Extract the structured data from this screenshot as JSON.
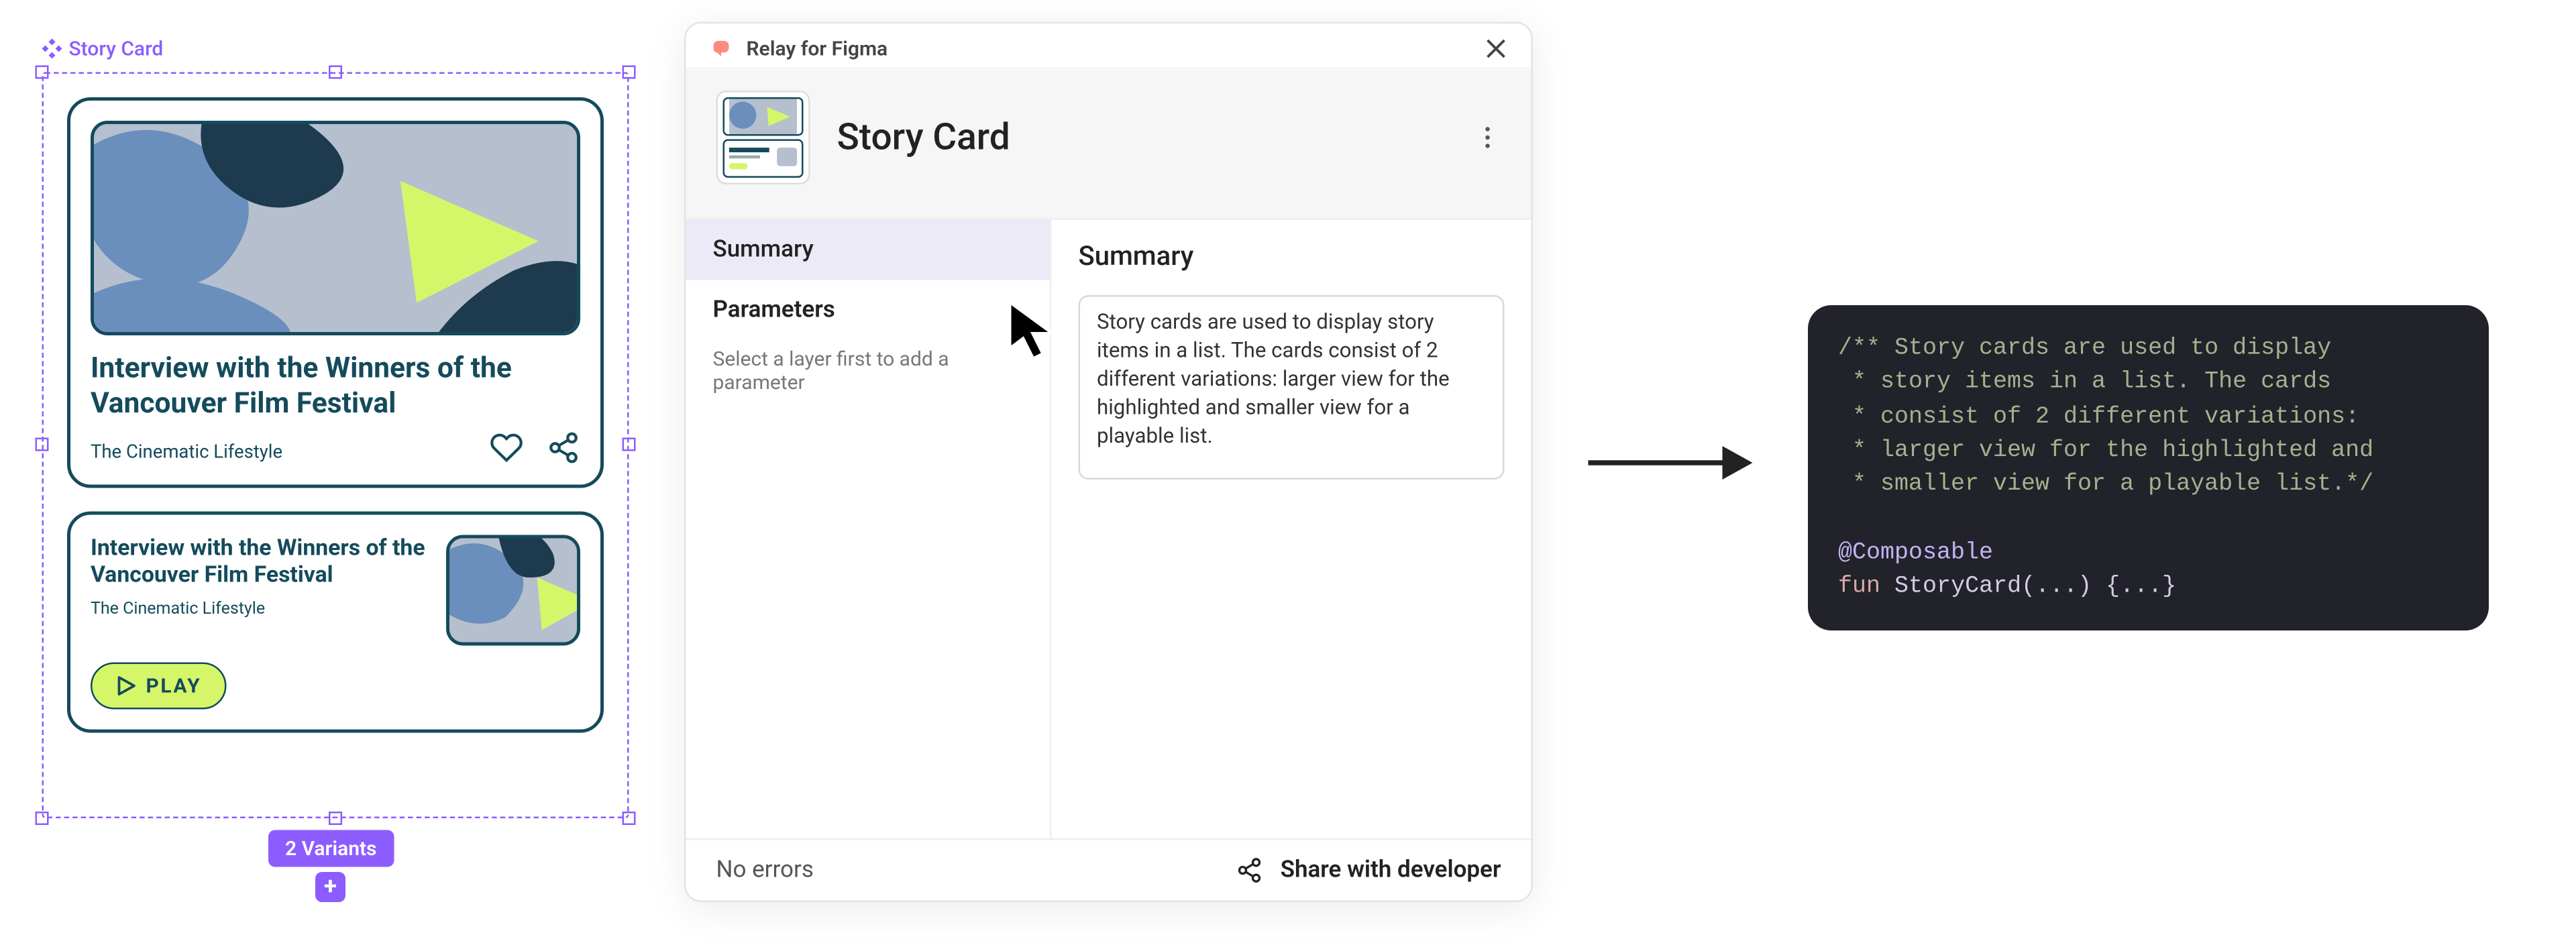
{
  "figma": {
    "component_label": "Story Card",
    "variants_badge": "2 Variants"
  },
  "card_large": {
    "title": "Interview with the Winners of the Vancouver Film Festival",
    "subtitle": "The Cinematic Lifestyle"
  },
  "card_small": {
    "title": "Interview with the Winners of the Vancouver Film Festival",
    "subtitle": "The Cinematic Lifestyle",
    "play_label": "PLAY"
  },
  "panel": {
    "plugin_name": "Relay for Figma",
    "title": "Story Card",
    "tabs": {
      "summary": "Summary",
      "parameters": "Parameters"
    },
    "hint": "Select a layer first to add a parameter",
    "main_heading": "Summary",
    "summary_text": "Story cards are used to display story items in a list. The cards consist of 2 different variations: larger view for the highlighted and smaller view for a playable list.",
    "footer": {
      "status": "No errors",
      "share": "Share with developer"
    }
  },
  "code": {
    "l1": "/** Story cards are used to display",
    "l2": " * story items in a list. The cards",
    "l3": " * consist of 2 different variations:",
    "l4": " * larger view for the highlighted and",
    "l5": " * smaller view for a playable list.*/",
    "l6": "@Composable",
    "l7a": "fun",
    "l7b": " StoryCard(...) {...}"
  }
}
